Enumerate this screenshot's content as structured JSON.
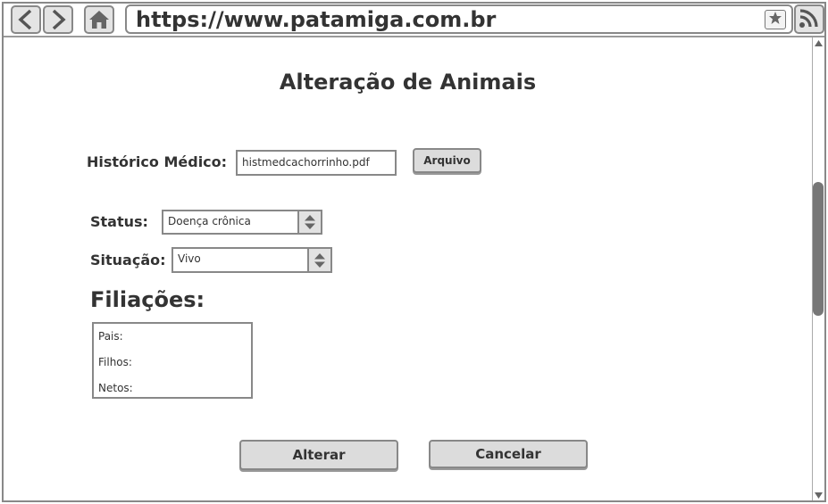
{
  "browser": {
    "url": "https://www.patamiga.com.br",
    "icons": [
      "back-icon",
      "forward-icon",
      "home-icon",
      "star-icon",
      "rss-icon"
    ]
  },
  "page": {
    "title": "Alteração de Animais"
  },
  "form": {
    "historico_label": "Histórico Médico:",
    "historico_value": "histmedcachorrinho.pdf",
    "arquivo_button": "Arquivo",
    "status_label": "Status:",
    "status_value": "Doença crônica",
    "situacao_label": "Situação:",
    "situacao_value": "Vivo"
  },
  "filiacoes": {
    "title": "Filiações:",
    "items": [
      "Pais:",
      "Filhos:",
      "Netos:"
    ]
  },
  "actions": {
    "alterar": "Alterar",
    "cancelar": "Cancelar"
  }
}
